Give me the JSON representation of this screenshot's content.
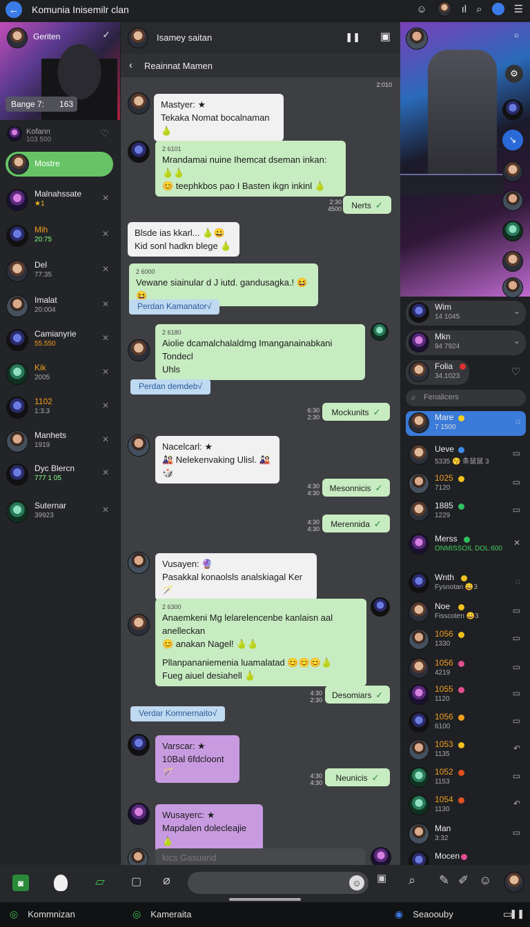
{
  "topbar": {
    "title": "Komunia Inisemilr clan"
  },
  "left": {
    "hero_name": "Geriten",
    "hero_chip_a": "Bange 7:",
    "hero_chip_b": "163",
    "items": [
      {
        "name": "Kofann",
        "sub": "103 500"
      },
      {
        "name": "Mostre",
        "sub": ""
      },
      {
        "name": "Malnahssate",
        "sub": "★1"
      },
      {
        "name": "Mih",
        "sub": "20:75"
      },
      {
        "name": "Del",
        "sub": "77:35"
      },
      {
        "name": "Imalat",
        "sub": "20:004"
      },
      {
        "name": "Camianyrie",
        "sub": "55.550"
      },
      {
        "name": "Kik",
        "sub": "2005"
      },
      {
        "name": "1102",
        "sub": "1:3.3"
      },
      {
        "name": "Manhets",
        "sub": "1919"
      },
      {
        "name": "Dyc Blercn",
        "sub": "777 1 05"
      },
      {
        "name": "Suternar",
        "sub": "39923"
      }
    ]
  },
  "mid": {
    "header_name": "Isamey saitan",
    "subheader": "Reainnat Mamen",
    "messages": [
      {
        "kind": "time",
        "text": "2:010"
      },
      {
        "kind": "in",
        "lines": [
          "Mastyer: ★",
          "Tekaka Nomat bocalnaman 🍐"
        ]
      },
      {
        "kind": "gr",
        "time": "2 6101",
        "lines": [
          "Mrandamai nuine Ihemcat dseman inkan: 🍐🍐",
          "😊 teephkbos pao I Basten ikgn inkinl 🍐"
        ]
      },
      {
        "kind": "out",
        "text": "Nerts",
        "meta": "2:30 4500"
      },
      {
        "kind": "in",
        "lines": [
          "Blsde ias kkarl... 🍐😀",
          "Kid sonl hadkn blege 🍐"
        ]
      },
      {
        "kind": "gr",
        "time": "2 6000",
        "lines": [
          "Vewane siainular d J iutd. gandusagka.! 😆😆"
        ]
      },
      {
        "kind": "pill",
        "text": "Perdan Kamanator√"
      },
      {
        "kind": "gr",
        "time": "2 6180",
        "lines": [
          "Aiolie dcamalchalaldmg Imanganainabkani Tondecl",
          "Uhls"
        ]
      },
      {
        "kind": "pill",
        "text": "Perdan demdeb√"
      },
      {
        "kind": "out",
        "text": "Mockunits",
        "meta": "6:30 2:30"
      },
      {
        "kind": "in",
        "lines": [
          "Nacelcarl: ★",
          "🎎 Nelekenvaking Ulisl. 🎎🎲"
        ]
      },
      {
        "kind": "out",
        "text": "Mesonnicis",
        "meta": "4:30 4:30"
      },
      {
        "kind": "out",
        "text": "Merennida",
        "meta": "4:30 4:30"
      },
      {
        "kind": "in",
        "lines": [
          "Vusayen: 🔮",
          "Pasakkal konaolsls analskiagal Ker 🪄"
        ]
      },
      {
        "kind": "gr",
        "time": "2 6300",
        "lines": [
          "Anaemkeni Mg lelarelencenbe kanlaisn aal anelleckan",
          "😊 anakan Nagel! 🍐🍐",
          "",
          "Pllanpananiemenia luamalatad 😊😊😊🍐",
          "Fueg aiuel desiahell 🍐"
        ]
      },
      {
        "kind": "out",
        "text": "Desomiars",
        "meta": "4:30 2:30"
      },
      {
        "kind": "pill",
        "text": "Verdar Komnernaito√"
      },
      {
        "kind": "pu",
        "lines": [
          "Varscar: ★",
          "10Bal 6fdcloont 🪄"
        ]
      },
      {
        "kind": "out",
        "text": "Neunicis",
        "meta": "4:30 4:30"
      },
      {
        "kind": "pu",
        "lines": [
          "Wusayerc: ★",
          "Mapdalen dolecleajie 🍐"
        ]
      },
      {
        "kind": "in-faint",
        "text": "kics Gasuarid"
      }
    ]
  },
  "right": {
    "cards": [
      {
        "name": "Wim",
        "sub": "14 1045"
      },
      {
        "name": "Mkn",
        "sub": "94 7924"
      },
      {
        "name": "Folia",
        "sub": "34.1023"
      }
    ],
    "search_placeholder": "Fenalicers",
    "list": [
      {
        "name": "Mare",
        "sub": "7 1500",
        "dot": "#f0d020"
      },
      {
        "name": "Ueve",
        "sub": "5335 😚 条鼠鼠 3",
        "dot": "#3b8be8"
      },
      {
        "name": "1025",
        "sub": "7120",
        "dot": "#f0c020"
      },
      {
        "name": "1885",
        "sub": "1229",
        "dot": "#30c060"
      },
      {
        "name": "Merss",
        "sub": "ONMISSOIL DOL:600",
        "dot": "#30c060"
      },
      {
        "name": "Wnth",
        "sub": "Fysnotan 😀3",
        "dot": "#f0c020"
      },
      {
        "name": "Noe",
        "sub": "Fisscoten 😀3",
        "dot": "#f0c020"
      },
      {
        "name": "1056",
        "sub": "1330",
        "dot": "#f0c020"
      },
      {
        "name": "1056",
        "sub": "4219",
        "dot": "#e05090"
      },
      {
        "name": "1055",
        "sub": "1120",
        "dot": "#e05090"
      },
      {
        "name": "1056",
        "sub": "6100",
        "dot": "#f0a020"
      },
      {
        "name": "1053",
        "sub": "1135",
        "dot": "#f0c020"
      },
      {
        "name": "1052",
        "sub": "1153",
        "dot": "#e05020"
      },
      {
        "name": "1054",
        "sub": "1130",
        "dot": "#e05020"
      },
      {
        "name": "Man",
        "sub": "3:32",
        "dot": ""
      },
      {
        "name": "Mocen",
        "sub": "",
        "dot": "#e05090"
      }
    ]
  },
  "bottom": {
    "nav": [
      "Kommnizan",
      "Kameraita",
      "Seaoouby"
    ]
  }
}
